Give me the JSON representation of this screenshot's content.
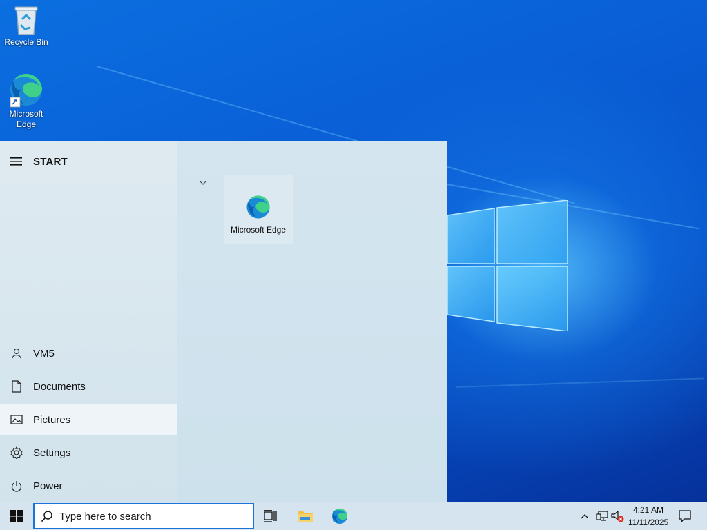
{
  "desktop": {
    "icons": [
      {
        "label": "Recycle Bin",
        "icon": "recycle-bin-icon"
      },
      {
        "label": "Microsoft\nEdge",
        "icon": "edge-icon"
      }
    ]
  },
  "start_menu": {
    "title": "START",
    "side_items": [
      {
        "label": "VM5",
        "icon": "user-icon"
      },
      {
        "label": "Documents",
        "icon": "document-icon"
      },
      {
        "label": "Pictures",
        "icon": "pictures-icon"
      },
      {
        "label": "Settings",
        "icon": "gear-icon"
      },
      {
        "label": "Power",
        "icon": "power-icon"
      }
    ],
    "tiles": [
      {
        "label": "Microsoft Edge",
        "icon": "edge-icon"
      }
    ]
  },
  "taskbar": {
    "search_placeholder": "Type here to search",
    "pinned": [
      "task-view-icon",
      "file-explorer-icon",
      "edge-icon"
    ],
    "clock": {
      "time": "4:21 AM",
      "date": "11/11/2025"
    }
  },
  "colors": {
    "accent": "#1a73d9",
    "taskbar_bg": "#d5e4ee",
    "menu_bg": "#dfeaf0",
    "active_item_bg": "#eef4f7"
  }
}
